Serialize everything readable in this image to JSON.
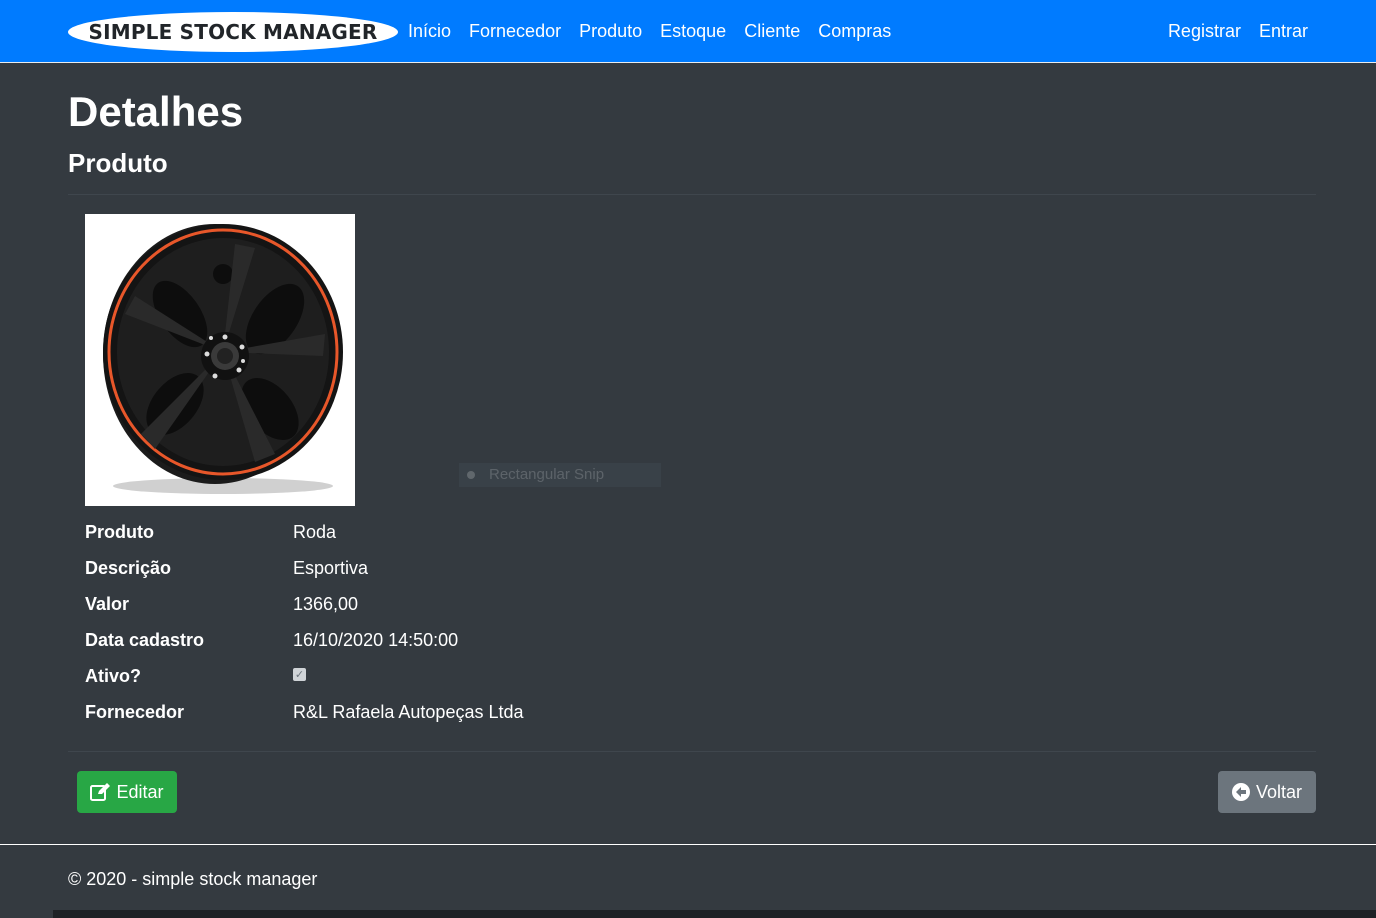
{
  "navbar": {
    "brand": "SIMPLE STOCK MANAGER",
    "links": [
      "Início",
      "Fornecedor",
      "Produto",
      "Estoque",
      "Cliente",
      "Compras"
    ],
    "right_links": [
      "Registrar",
      "Entrar"
    ],
    "color": "#007bff"
  },
  "page": {
    "title": "Detalhes",
    "subtitle": "Produto"
  },
  "overlay": {
    "label": "Rectangular Snip"
  },
  "details": [
    {
      "label": "Produto",
      "value": "Roda"
    },
    {
      "label": "Descrição",
      "value": "Esportiva"
    },
    {
      "label": "Valor",
      "value": "1366,00"
    },
    {
      "label": "Data cadastro",
      "value": "16/10/2020 14:50:00"
    },
    {
      "label": "Ativo?",
      "value": "",
      "checked": true
    },
    {
      "label": "Fornecedor",
      "value": "R&L Rafaela Autopeças Ltda"
    }
  ],
  "actions": {
    "edit_label": "Editar",
    "back_label": "Voltar",
    "edit_color": "#28a745",
    "back_color": "#6c757d",
    "edit_icon": "edit-icon",
    "back_icon": "arrow-left-circle-icon"
  },
  "footer": {
    "text": "© 2020 - simple stock manager"
  }
}
